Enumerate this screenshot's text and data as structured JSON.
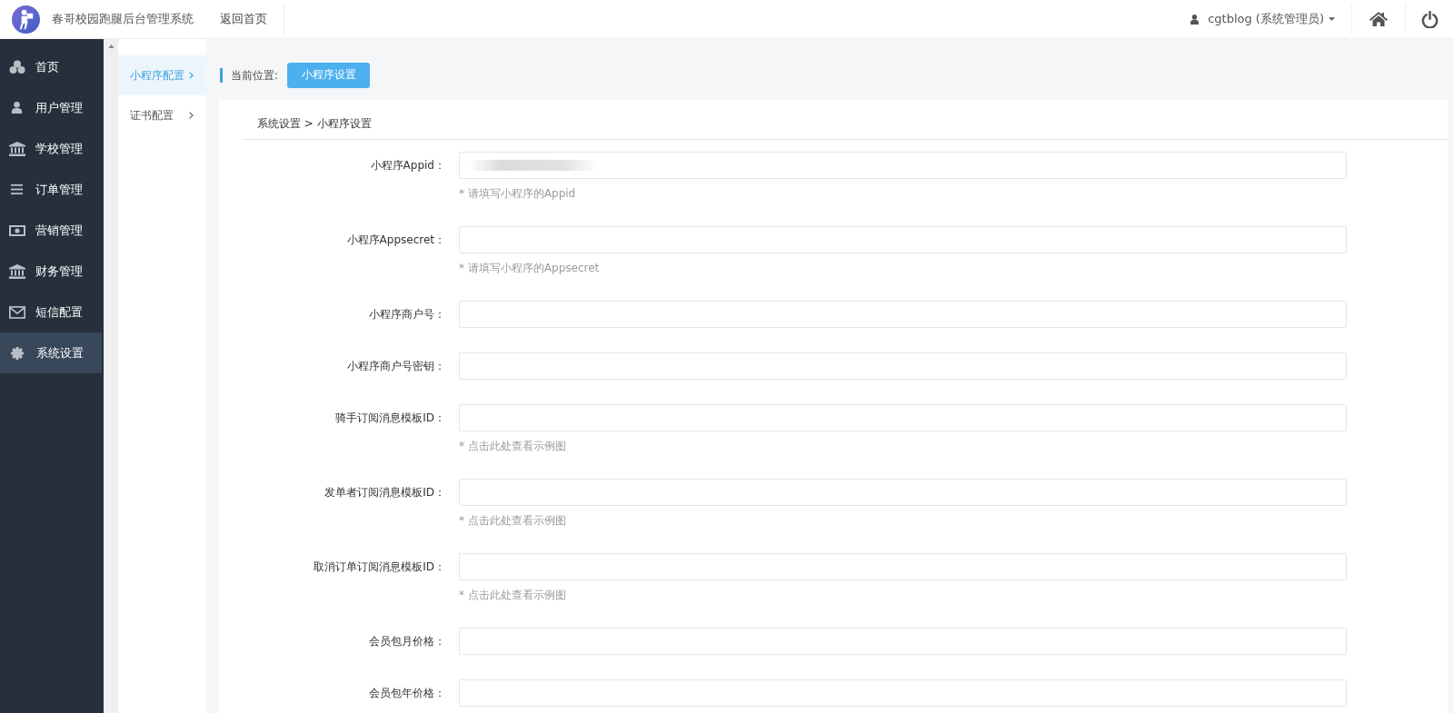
{
  "header": {
    "title": "春哥校园跑腿后台管理系统",
    "home_link": "返回首页",
    "user": "cgtblog (系统管理员)"
  },
  "sidebar": {
    "items": [
      {
        "label": "首页",
        "selected": false
      },
      {
        "label": "用户管理",
        "selected": false
      },
      {
        "label": "学校管理",
        "selected": false
      },
      {
        "label": "订单管理",
        "selected": false
      },
      {
        "label": "营销管理",
        "selected": false
      },
      {
        "label": "财务管理",
        "selected": false
      },
      {
        "label": "短信配置",
        "selected": false
      },
      {
        "label": "系统设置",
        "selected": true
      }
    ]
  },
  "submenu": {
    "items": [
      {
        "label": "小程序配置",
        "selected": true
      },
      {
        "label": "证书配置",
        "selected": false
      }
    ]
  },
  "location": {
    "label": "当前位置:",
    "current": "小程序设置"
  },
  "form": {
    "breadcrumb": "系统设置 > 小程序设置",
    "fields": [
      {
        "label": "小程序Appid：",
        "hint": "* 请填写小程序的Appid",
        "blurred": true
      },
      {
        "label": "小程序Appsecret：",
        "hint": "* 请填写小程序的Appsecret",
        "blurred": false
      },
      {
        "label": "小程序商户号：",
        "blurred": false
      },
      {
        "label": "小程序商户号密钥：",
        "blurred": false
      },
      {
        "label": "骑手订阅消息模板ID：",
        "hint": "* 点击此处查看示例图",
        "blurred": false
      },
      {
        "label": "发单者订阅消息模板ID：",
        "hint": "* 点击此处查看示例图",
        "blurred": false
      },
      {
        "label": "取消订单订阅消息模板ID：",
        "hint": "* 点击此处查看示例图",
        "blurred": false
      },
      {
        "label": "会员包月价格：",
        "blurred": false
      },
      {
        "label": "会员包年价格：",
        "blurred": false
      }
    ]
  }
}
